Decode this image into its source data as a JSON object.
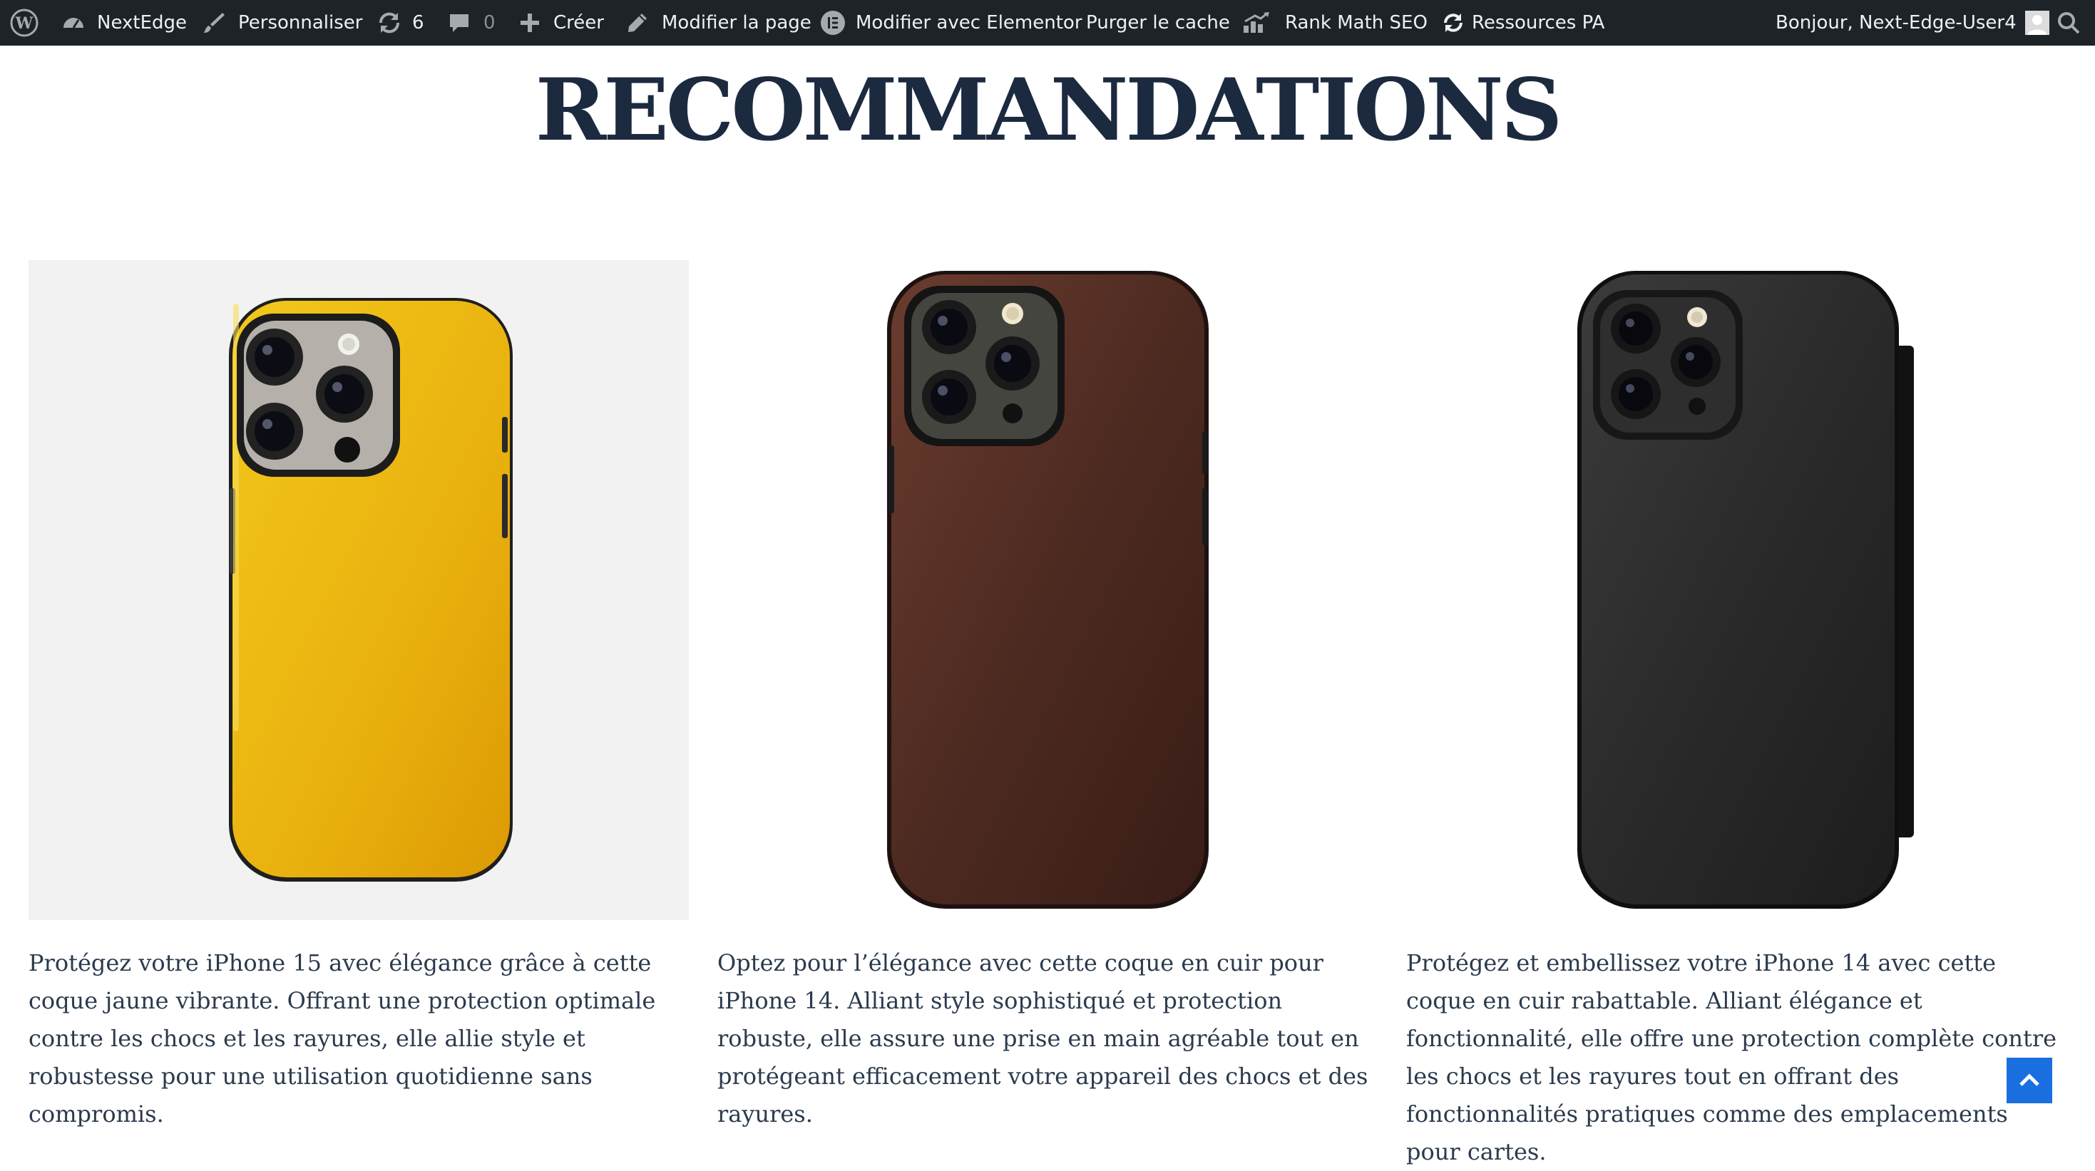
{
  "adminbar": {
    "site_name": "NextEdge",
    "customize": "Personnaliser",
    "updates_count": "6",
    "comments_count": "0",
    "new": "Créer",
    "edit_page": "Modifier la page",
    "edit_elementor": "Modifier avec Elementor",
    "purge_cache": "Purger le cache",
    "rank_math": "Rank Math SEO",
    "resources": "Ressources PA",
    "greeting": "Bonjour, Next-Edge-User4",
    "icons": [
      "wordpress-icon",
      "dashboard-icon",
      "brush-icon",
      "updates-icon",
      "comment-icon",
      "plus-icon",
      "pencil-icon",
      "elementor-icon",
      "rank-math-icon",
      "refresh-icon",
      "avatar-icon",
      "search-icon"
    ]
  },
  "section": {
    "title": "RECOMMANDATIONS"
  },
  "products": [
    {
      "image": "yellow-iphone-15-case",
      "description": "Protégez votre iPhone 15 avec élégance grâce à cette coque jaune vibrante. Offrant une protection optimale contre les chocs et les rayures, elle allie style et robustesse pour une utilisation quotidienne sans compromis."
    },
    {
      "image": "brown-leather-iphone-14-case",
      "description": "Optez pour l’élégance avec cette coque en cuir pour iPhone 14. Alliant style sophistiqué et protection robuste, elle assure une prise en main agréable tout en protégeant efficacement votre appareil des chocs et des rayures."
    },
    {
      "image": "black-leather-folio-iphone-14-case",
      "description": "Protégez et embellissez votre iPhone 14 avec cette coque en cuir rabattable. Alliant élégance et fonctionnalité, elle offre une protection complète contre les chocs et les rayures tout en offrant des fonctionnalités pratiques comme des emplacements pour cartes."
    }
  ],
  "colors": {
    "adminbar_bg": "#1d2327",
    "heading": "#1c2a40",
    "body_text": "#2b3a4d",
    "back_to_top": "#1a6fe0"
  },
  "back_to_top_icon": "chevron-up-icon"
}
